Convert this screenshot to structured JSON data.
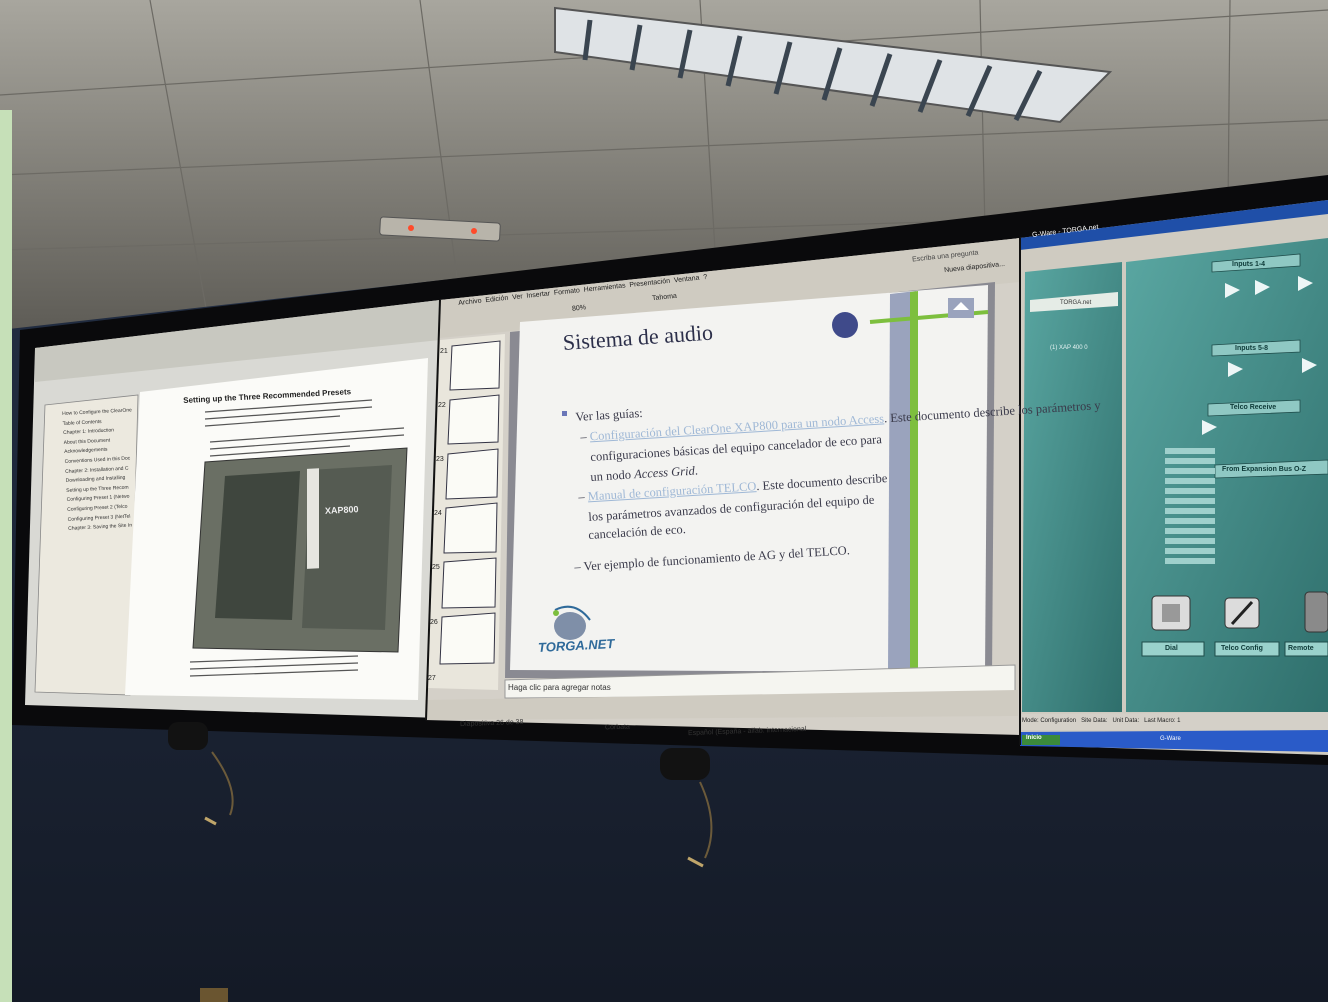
{
  "slide": {
    "title": "Sistema de audio",
    "bullet": "Ver las guías:",
    "line1_link": "Configuración del ClearOne XAP800 para un nodo Access",
    "line1_rest": ". Este documento describe los parámetros y",
    "line2": "configuraciones básicas del equipo cancelador de eco para",
    "line3a": "un nodo ",
    "line3b": "Access Grid",
    "line3c": ".",
    "line4_link": "Manual de configuración TELCO",
    "line4_rest": ". Este documento describe",
    "line5": "los parámetros avanzados de configuración del equipo de",
    "line6": "cancelación de eco.",
    "line7": "Ver ejemplo de funcionamiento de AG y del TELCO.",
    "notes_placeholder": "Haga clic para agregar notas",
    "logo": "TORGA.NET"
  },
  "pdf": {
    "heading": "Setting up the Three Recommended Presets",
    "product": "XAP800",
    "bookmarks": [
      "How to Configure the ClearOne",
      "Table of Contents",
      "Chapter 1: Introduction",
      "About this Document",
      "Acknowledgements",
      "Conventions Used in this Doc",
      "Chapter 2: Installation and C",
      "Downloading and Installing",
      "Setting up the Three Recom",
      "Configuring Preset 1 (Netwo",
      "Configuring Preset 2 (Telco",
      "Configuring Preset 3 (NetTel",
      "Chapter 3: Saving the Site In"
    ]
  },
  "ppt": {
    "menu": [
      "Archivo",
      "Edición",
      "Ver",
      "Insertar",
      "Formato",
      "Herramientas",
      "Presentación",
      "Ventana",
      "?"
    ],
    "font": "Tahoma",
    "zoom": "80%",
    "slide_numbers": [
      "21",
      "22",
      "23",
      "24",
      "25",
      "26",
      "27"
    ],
    "status_slide": "Diapositiva 26 de 38",
    "status_design": "Corbata",
    "status_lang": "Español (España - alfab. internacional",
    "help_box": "Escriba una pregunta",
    "new_slide": "Nueva diapositiva..."
  },
  "gware": {
    "title": "G-Ware - TORGA.net",
    "tree_root": "TORGA.net",
    "device": "(1) XAP 400 0",
    "blocks": [
      "Inputs 1-4",
      "Inputs 5-8",
      "Telco Receive",
      "From Expansion Bus O-Z"
    ],
    "buttons": [
      "Dial",
      "Telco Config",
      "Remote"
    ],
    "status": [
      "Mode: Configuration",
      "Site Data:",
      "Unit Data:",
      "Last Macro: 1"
    ],
    "taskbar_start": "Inicio",
    "taskbar_task": "G-Ware"
  },
  "colors": {
    "slide_bg": "#f3f3f1",
    "teal_panel": "#3f8a86",
    "green_accent": "#7dbf3e",
    "ceiling": "#8a8880",
    "wall": "#1d2636"
  }
}
